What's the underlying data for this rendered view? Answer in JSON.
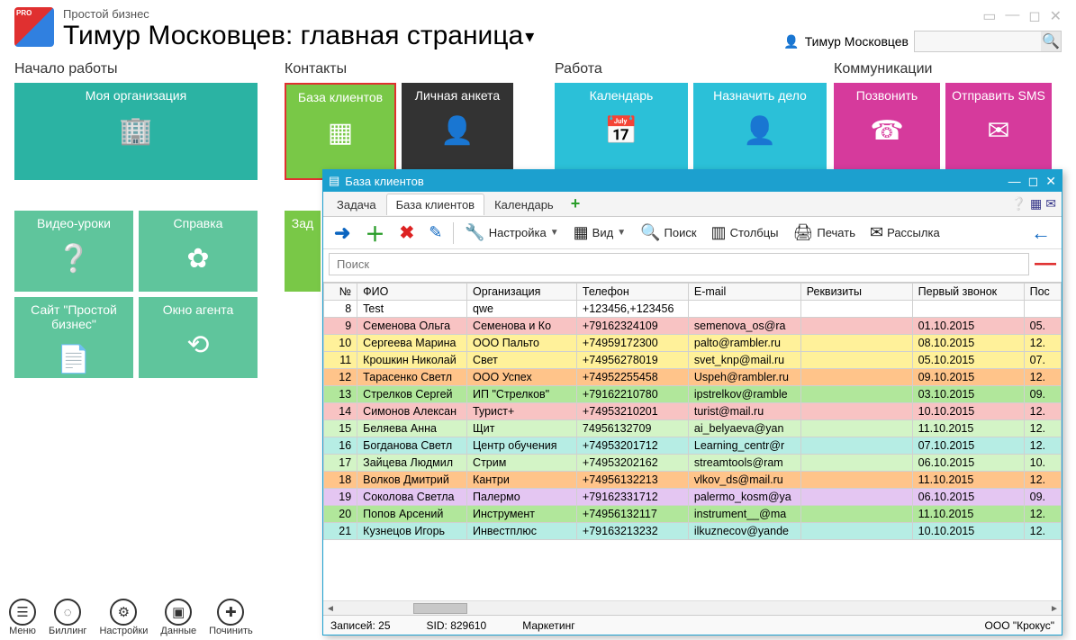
{
  "app": {
    "subtitle": "Простой бизнес",
    "title": "Тимур Московцев: главная страница"
  },
  "user_name": "Тимур Московцев",
  "search_placeholder": "",
  "sections": {
    "s1": "Начало работы",
    "s2": "Контакты",
    "s3": "Работа",
    "s4": "Коммуникации"
  },
  "tiles": {
    "my_org": "Моя организация",
    "video": "Видео-уроки",
    "help": "Справка",
    "site": "Сайт \"Простой бизнес\"",
    "agent": "Окно агента",
    "clients": "База клиентов",
    "profile": "Личная анкета",
    "task": "Зад",
    "calendar": "Календарь",
    "assign": "Назначить дело",
    "call": "Позвонить",
    "sms": "Отправить SMS"
  },
  "bottom": {
    "menu": "Меню",
    "billing": "Биллинг",
    "settings": "Настройки",
    "data": "Данные",
    "repair": "Починить"
  },
  "popup": {
    "title": "База клиентов",
    "tabs": {
      "task": "Задача",
      "clients": "База клиентов",
      "cal": "Календарь"
    },
    "toolbar": {
      "config": "Настройка",
      "view": "Вид",
      "search": "Поиск",
      "cols": "Столбцы",
      "print": "Печать",
      "mail": "Рассылка"
    },
    "search_placeholder": "Поиск",
    "headers": {
      "num": "№",
      "fio": "ФИО",
      "org": "Организация",
      "tel": "Телефон",
      "email": "E-mail",
      "rek": "Реквизиты",
      "first": "Первый звонок",
      "last": "Пос"
    },
    "rows": [
      {
        "n": "8",
        "fio": "Test",
        "org": "qwe",
        "tel": "+123456,+123456",
        "em": "",
        "rek": "",
        "fc": "",
        "lc": "",
        "cls": "row-white"
      },
      {
        "n": "9",
        "fio": "Семенова Ольга",
        "org": "Семенова и Ко",
        "tel": "+79162324109",
        "em": "semenova_os@ra",
        "rek": "",
        "fc": "01.10.2015",
        "lc": "05.",
        "cls": "row-pink"
      },
      {
        "n": "10",
        "fio": "Сергеева Марина",
        "org": "ООО Пальто",
        "tel": "+74959172300",
        "em": "palto@rambler.ru",
        "rek": "",
        "fc": "08.10.2015",
        "lc": "12.",
        "cls": "row-yellow"
      },
      {
        "n": "11",
        "fio": "Крошкин Николай",
        "org": "Свет",
        "tel": "+74956278019",
        "em": "svet_knp@mail.ru",
        "rek": "",
        "fc": "05.10.2015",
        "lc": "07.",
        "cls": "row-yellow"
      },
      {
        "n": "12",
        "fio": "Тарасенко Светл",
        "org": "ООО Успех",
        "tel": "+74952255458",
        "em": "Uspeh@rambler.ru",
        "rek": "",
        "fc": "09.10.2015",
        "lc": "12.",
        "cls": "row-orange"
      },
      {
        "n": "13",
        "fio": "Стрелков Сергей",
        "org": "ИП \"Стрелков\"",
        "tel": "+79162210780",
        "em": "ipstrelkov@ramble",
        "rek": "",
        "fc": "03.10.2015",
        "lc": "09.",
        "cls": "row-green"
      },
      {
        "n": "14",
        "fio": "Симонов Алексан",
        "org": "Турист+",
        "tel": "+74953210201",
        "em": "turist@mail.ru",
        "rek": "",
        "fc": "10.10.2015",
        "lc": "12.",
        "cls": "row-pink"
      },
      {
        "n": "15",
        "fio": "Беляева Анна",
        "org": "Щит",
        "tel": "74956132709",
        "em": "ai_belyaeva@yan",
        "rek": "",
        "fc": "11.10.2015",
        "lc": "12.",
        "cls": "row-lgreen"
      },
      {
        "n": "16",
        "fio": "Богданова Светл",
        "org": "Центр обучения",
        "tel": "+74953201712",
        "em": "Learning_centr@r",
        "rek": "",
        "fc": "07.10.2015",
        "lc": "12.",
        "cls": "row-cyan"
      },
      {
        "n": "17",
        "fio": "Зайцева Людмил",
        "org": "Стрим",
        "tel": "+74953202162",
        "em": "streamtools@ram",
        "rek": "",
        "fc": "06.10.2015",
        "lc": "10.",
        "cls": "row-lgreen"
      },
      {
        "n": "18",
        "fio": "Волков Дмитрий",
        "org": "Кантри",
        "tel": "+74956132213",
        "em": "vlkov_ds@mail.ru",
        "rek": "",
        "fc": "11.10.2015",
        "lc": "12.",
        "cls": "row-orange"
      },
      {
        "n": "19",
        "fio": "Соколова Светла",
        "org": "Палермо",
        "tel": "+79162331712",
        "em": "palermo_kosm@ya",
        "rek": "",
        "fc": "06.10.2015",
        "lc": "09.",
        "cls": "row-purple"
      },
      {
        "n": "20",
        "fio": "Попов Арсений",
        "org": "Инструмент",
        "tel": "+74956132117",
        "em": "instrument__@ma",
        "rek": "",
        "fc": "11.10.2015",
        "lc": "12.",
        "cls": "row-green"
      },
      {
        "n": "21",
        "fio": "Кузнецов Игорь",
        "org": "Инвестплюс",
        "tel": "+79163213232",
        "em": "ilkuznecov@yande",
        "rek": "",
        "fc": "10.10.2015",
        "lc": "12.",
        "cls": "row-cyan"
      }
    ],
    "status": {
      "records": "Записей: 25",
      "sid": "SID: 829610",
      "marketing": "Маркетинг",
      "company": "ООО \"Крокус\""
    }
  }
}
